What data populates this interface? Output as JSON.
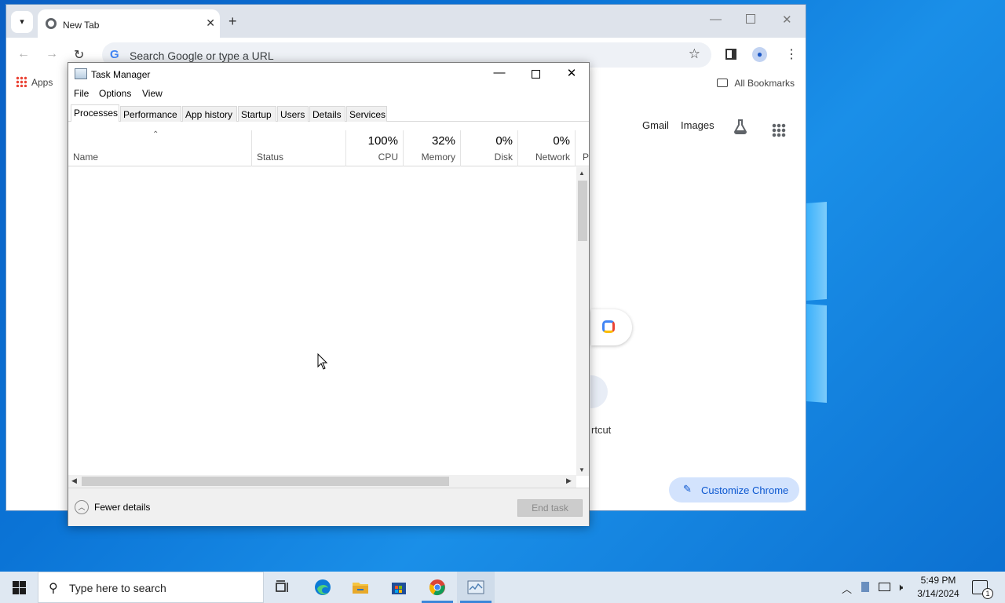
{
  "chrome": {
    "tab_title": "New Tab",
    "omnibox_placeholder": "Search Google or type a URL",
    "bookmarks": {
      "apps_label": "Apps",
      "all_bookmarks_label": "All Bookmarks"
    },
    "ntp": {
      "gmail": "Gmail",
      "images": "Images",
      "shortcut_label_fragment": "rtcut",
      "customize_label": "Customize Chrome"
    }
  },
  "task_manager": {
    "title": "Task Manager",
    "menu": [
      "File",
      "Options",
      "View"
    ],
    "tabs": [
      "Processes",
      "Performance",
      "App history",
      "Startup",
      "Users",
      "Details",
      "Services"
    ],
    "active_tab": "Processes",
    "columns": {
      "name": "Name",
      "status": "Status",
      "cpu": {
        "percent": "100%",
        "label": "CPU"
      },
      "memory": {
        "percent": "32%",
        "label": "Memory"
      },
      "disk": {
        "percent": "0%",
        "label": "Disk"
      },
      "network": {
        "percent": "0%",
        "label": "Network"
      },
      "truncated": "P"
    },
    "fewer_details": "Fewer details",
    "end_task": "End task"
  },
  "taskbar": {
    "search_placeholder": "Type here to search",
    "time": "5:49 PM",
    "date": "3/14/2024",
    "notification_count": "1"
  }
}
